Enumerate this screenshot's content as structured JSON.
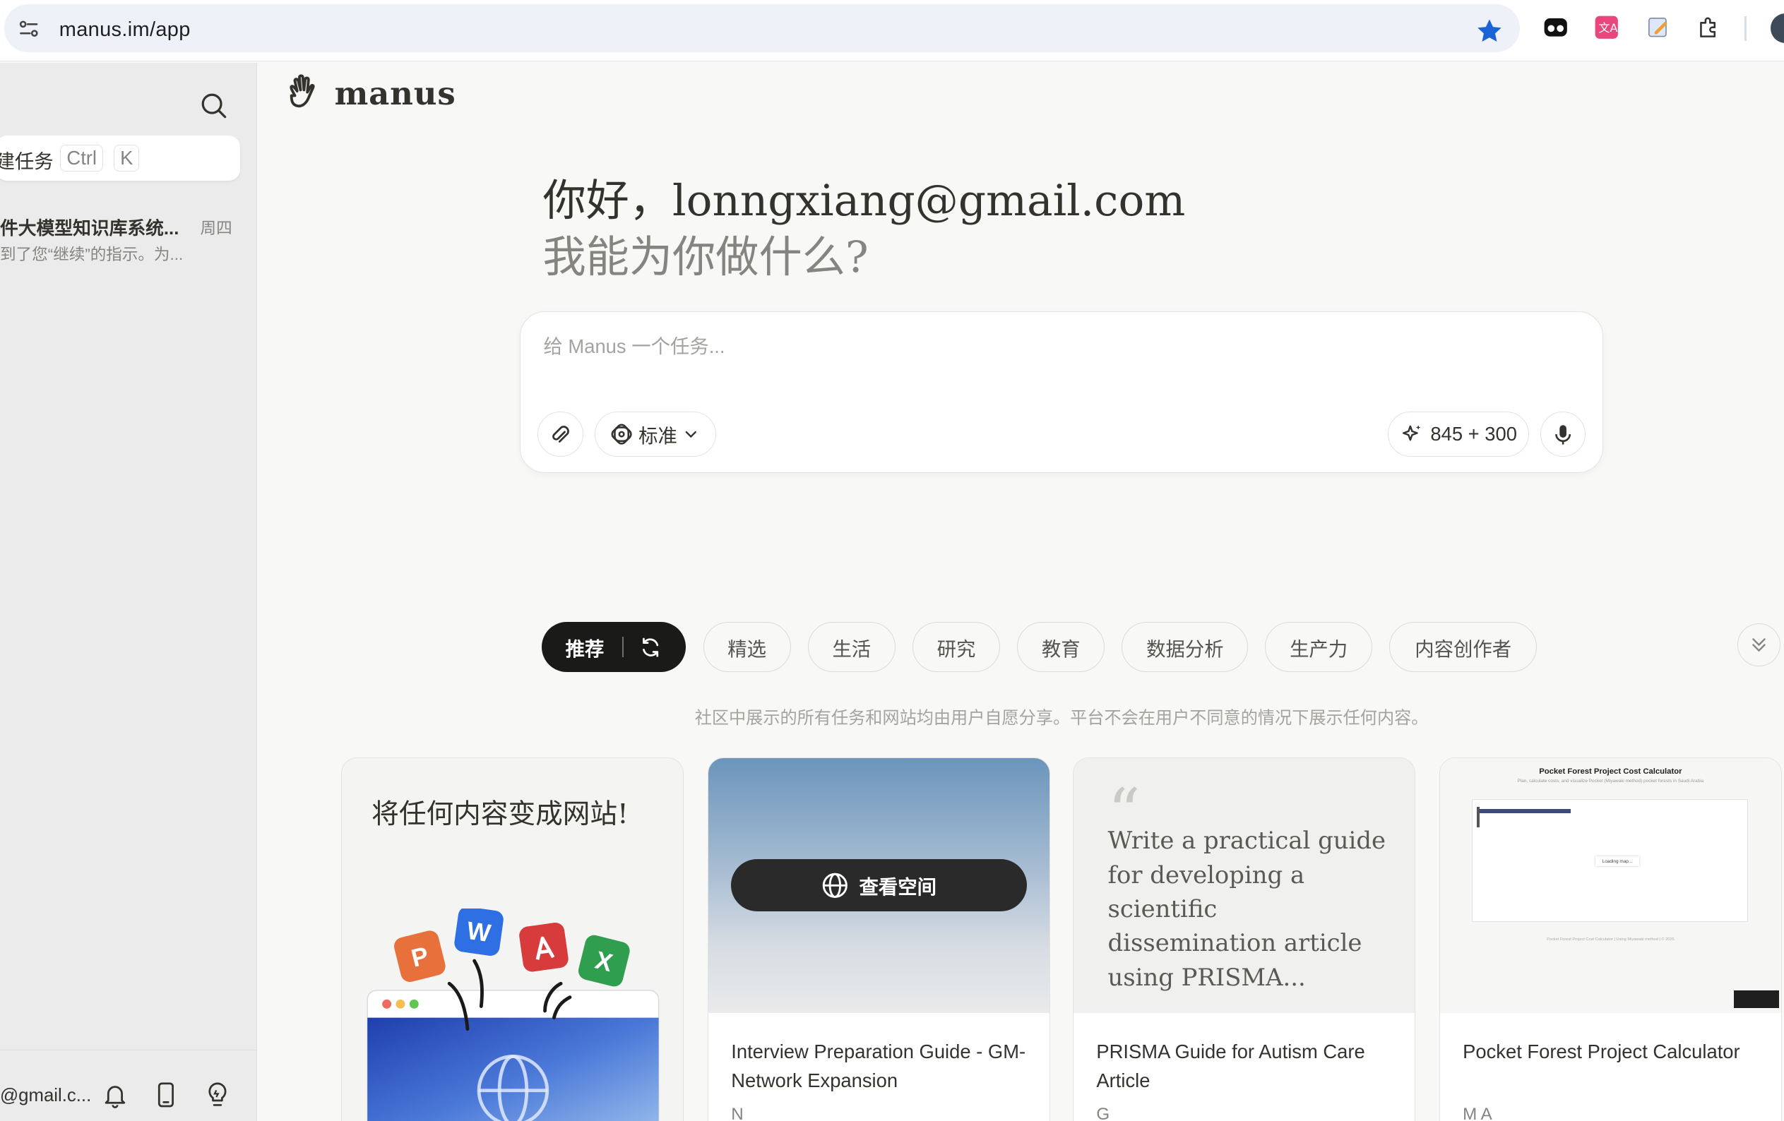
{
  "browser": {
    "url": "manus.im/app"
  },
  "sidebar": {
    "new_task": {
      "label": "建任务",
      "shortcut_ctrl": "Ctrl",
      "shortcut_key": "K"
    },
    "tasks": [
      {
        "title": "件大模型知识库系统...",
        "day": "周四",
        "preview": "到了您“继续”的指示。为..."
      }
    ],
    "footer": {
      "account": "@gmail.c..."
    }
  },
  "brand": {
    "name": "manus"
  },
  "hero": {
    "greeting": "你好，lonngxiang@gmail.com",
    "subtitle": "我能为你做什么?"
  },
  "composer": {
    "placeholder": "给 Manus 一个任务...",
    "mode_label": "标准",
    "credits": "845 + 300"
  },
  "tabs": {
    "active": "推荐",
    "items": [
      "精选",
      "生活",
      "研究",
      "教育",
      "数据分析",
      "生产力",
      "内容创作者"
    ]
  },
  "disclaimer": "社区中展示的所有任务和网站均由用户自愿分享。平台不会在用户不同意的情况下展示任何内容。",
  "cards": [
    {
      "heading": "将任何内容变成网站!",
      "badges": [
        "P",
        "W",
        "X"
      ]
    },
    {
      "button_label": "查看空间",
      "title": "Interview Preparation Guide - GM-Network Expansion",
      "author": "N"
    },
    {
      "quote": "Write a practical guide for developing a scientific dissemination article using PRISMA...",
      "title": "PRISMA Guide for Autism Care Article",
      "author": "G"
    },
    {
      "preview_title": "Pocket Forest Project Cost Calculator",
      "preview_subtitle": "Plan, calculate costs, and visualize Pocket (Miyawaki method) pocket forests in Saudi Arabia",
      "preview_loading": "Loading map...",
      "preview_footer": "Pocket Forest Project Cost Calculator | Using Miyawaki method | © 2025",
      "title": "Pocket Forest Project Calculator",
      "author": "M A"
    }
  ],
  "colors": {
    "page_bg": "#f8f8f7",
    "sidebar_bg": "#ebebeb",
    "active_tab_bg": "#1a1a19",
    "bookmark_star": "#1a63d6",
    "text_primary": "#34322d",
    "text_muted": "#858481"
  }
}
